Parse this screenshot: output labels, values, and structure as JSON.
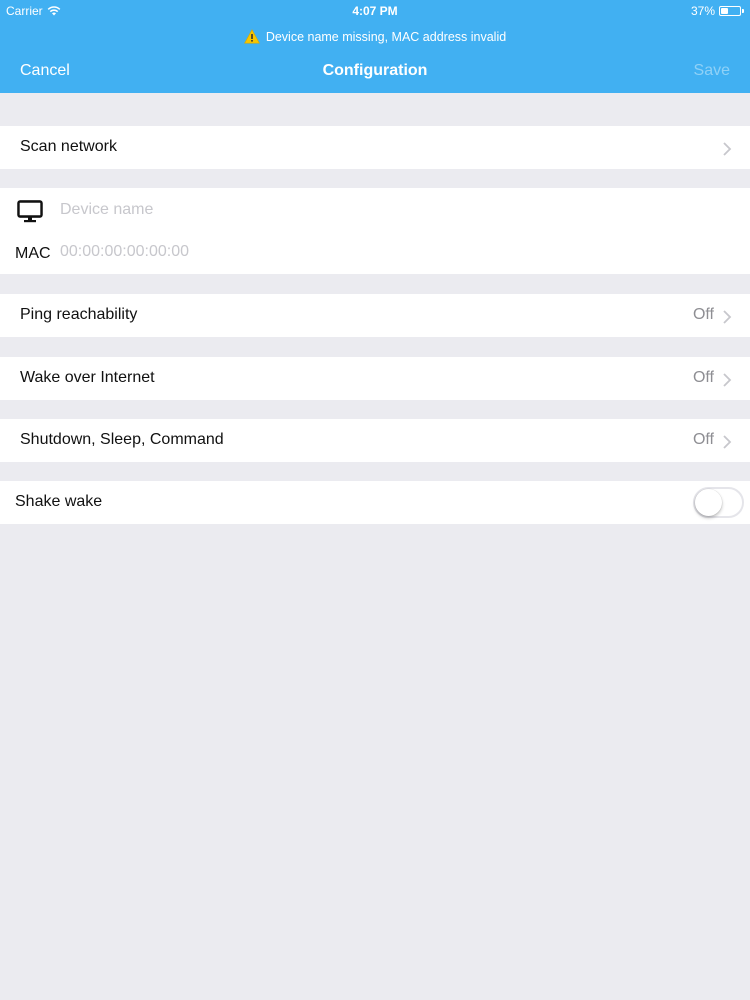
{
  "status_bar": {
    "carrier": "Carrier",
    "time": "4:07 PM",
    "battery_text": "37%",
    "battery_level": 0.37
  },
  "warning": {
    "text": "Device name missing, MAC address invalid",
    "icon": "warning-icon",
    "icon_color": "#f7c600"
  },
  "nav": {
    "cancel_label": "Cancel",
    "title": "Configuration",
    "save_label": "Save"
  },
  "colors": {
    "accent": "#41b0f2",
    "background": "#ebebf0",
    "secondary_text": "#8e8e93",
    "placeholder": "#c7c7cc"
  },
  "scan": {
    "label": "Scan network"
  },
  "device": {
    "icon": "monitor-icon",
    "name_value": "",
    "name_placeholder": "Device name",
    "mac_label": "MAC",
    "mac_value": "",
    "mac_placeholder": "00:00:00:00:00:00"
  },
  "ping": {
    "label": "Ping reachability",
    "value": "Off"
  },
  "wake": {
    "label": "Wake over Internet",
    "value": "Off"
  },
  "shutdown": {
    "label": "Shutdown, Sleep, Command",
    "value": "Off"
  },
  "shake": {
    "label": "Shake wake",
    "enabled": false
  }
}
